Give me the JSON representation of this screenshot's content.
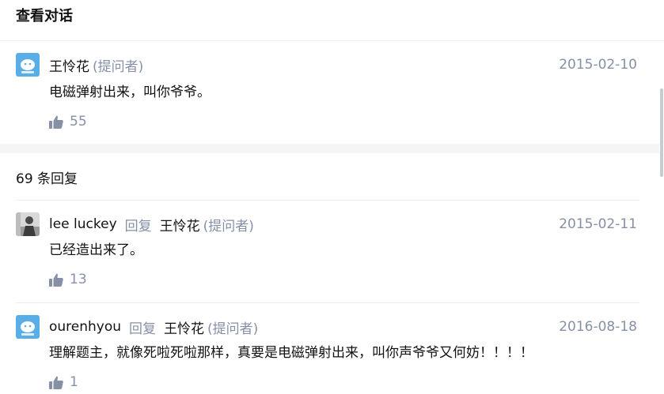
{
  "header": {
    "title": "查看对话"
  },
  "root_comment": {
    "author": "王怜花",
    "asker_tag": "(提问者)",
    "date": "2015-02-10",
    "content": "电磁弹射出来，叫你爷爷。",
    "likes": "55"
  },
  "reply_count_text": "69 条回复",
  "replies": [
    {
      "author": "lee luckey",
      "reply_word": "回复",
      "target": "王怜花",
      "asker_tag": "(提问者)",
      "date": "2015-02-11",
      "content": "已经造出来了。",
      "likes": "13"
    },
    {
      "author": "ourenhyou",
      "reply_word": "回复",
      "target": "王怜花",
      "asker_tag": "(提问者)",
      "date": "2016-08-18",
      "content": "理解题主，就像死啦死啦那样，真要是电磁弹射出来，叫你声爷爷又何妨！！！！",
      "likes": "1"
    }
  ],
  "colors": {
    "text_primary": "#121212",
    "text_secondary": "#8590a6",
    "divider": "#ebedf0",
    "section_gap": "#f4f5f6",
    "avatar_blue": "#5aaee8"
  },
  "icons": {
    "like": "thumbs-up-icon",
    "avatar_default": "zhihu-default-avatar-icon",
    "avatar_photo": "user-photo-avatar"
  }
}
